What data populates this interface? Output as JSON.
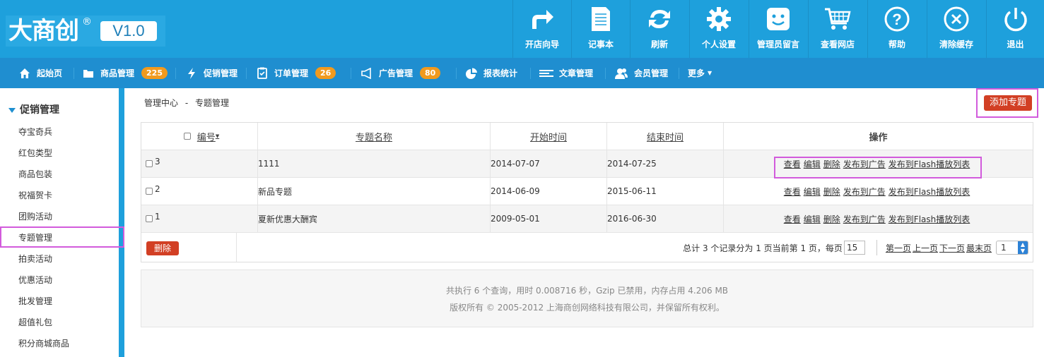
{
  "logo": {
    "text": "大商创",
    "reg": "®",
    "version": "V1.0"
  },
  "top_buttons": [
    {
      "icon": "arrow-redirect-icon",
      "label": "开店向导"
    },
    {
      "icon": "notepad-icon",
      "label": "记事本"
    },
    {
      "icon": "refresh-icon",
      "label": "刷新"
    },
    {
      "icon": "gear-icon",
      "label": "个人设置"
    },
    {
      "icon": "smiley-message-icon",
      "label": "管理员留言"
    },
    {
      "icon": "cart-icon",
      "label": "查看网店"
    },
    {
      "icon": "help-icon",
      "label": "帮助"
    },
    {
      "icon": "clear-cache-icon",
      "label": "清除缓存"
    },
    {
      "icon": "power-icon",
      "label": "退出"
    }
  ],
  "nav": [
    {
      "icon": "home-icon",
      "label": "起始页"
    },
    {
      "icon": "folder-icon",
      "label": "商品管理",
      "badge": "225"
    },
    {
      "icon": "lightning-icon",
      "label": "促销管理"
    },
    {
      "icon": "clipboard-icon",
      "label": "订单管理",
      "badge": "26"
    },
    {
      "icon": "megaphone-icon",
      "label": "广告管理",
      "badge": "80"
    },
    {
      "icon": "pie-chart-icon",
      "label": "报表统计"
    },
    {
      "icon": "list-icon",
      "label": "文章管理"
    },
    {
      "icon": "users-icon",
      "label": "会员管理"
    },
    {
      "label": "更多"
    }
  ],
  "sidebar": {
    "heading": "促销管理",
    "items": [
      "夺宝奇兵",
      "红包类型",
      "商品包装",
      "祝福贺卡",
      "团购活动",
      "专题管理",
      "拍卖活动",
      "优惠活动",
      "批发管理",
      "超值礼包",
      "积分商城商品"
    ],
    "active": "专题管理"
  },
  "breadcrumb": {
    "root": "管理中心",
    "sep": "-",
    "current": "专题管理"
  },
  "add_button": "添加专题",
  "table": {
    "headers": [
      "编号",
      "专题名称",
      "开始时间",
      "结束时间",
      "操作"
    ],
    "rows": [
      {
        "id": "3",
        "name": "1111",
        "start": "2014-07-07",
        "end": "2014-07-25"
      },
      {
        "id": "2",
        "name": "新品专题",
        "start": "2014-06-09",
        "end": "2015-06-11"
      },
      {
        "id": "1",
        "name": "夏新优惠大酬宾",
        "start": "2009-05-01",
        "end": "2016-06-30"
      }
    ],
    "actions": [
      "查看",
      "编辑",
      "删除",
      "发布到广告",
      "发布到Flash播放列表"
    ]
  },
  "delete_button": "删除",
  "pager": {
    "summary": "总计 3 个记录分为 1 页当前第 1 页，每页",
    "per_page": "15",
    "first": "第一页",
    "prev": "上一页",
    "next": "下一页",
    "last": "最末页",
    "page_select": "1"
  },
  "footer": {
    "line1": "共执行 6 个查询，用时 0.008716 秒，Gzip 已禁用，内存占用 4.206 MB",
    "line2": "版权所有 © 2005-2012 上海商创网络科技有限公司，并保留所有权利。"
  },
  "colors": {
    "topbar": "#1ea0dc",
    "navbar": "#1f8ed0",
    "badge": "#f19a1e",
    "danger_button": "#d23f24",
    "highlight": "#d25bdc"
  }
}
